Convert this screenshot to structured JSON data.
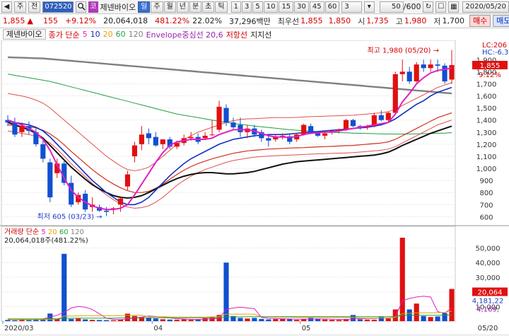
{
  "toolbar": {
    "nav_left": "◀",
    "type_label": "주",
    "prev_label": "전",
    "stock_code": "072520",
    "search_icon": "search-icon",
    "market_badge": "코",
    "stock_name": "제넨바이오",
    "period_tabs": [
      {
        "label": "일",
        "active": true
      },
      {
        "label": "주",
        "active": false
      },
      {
        "label": "월",
        "active": false
      },
      {
        "label": "년",
        "active": false
      },
      {
        "label": "분",
        "active": false
      },
      {
        "label": "초",
        "active": false
      },
      {
        "label": "틱",
        "active": false
      }
    ],
    "minute_buttons": [
      "1",
      "3",
      "5",
      "10",
      "15",
      "30",
      "45",
      "60"
    ],
    "minute_select": "3",
    "count_value": "50",
    "count_total": "/600",
    "date": "2020/05/20"
  },
  "price_bar": {
    "current_price": "1,855",
    "change_arrow": "▲",
    "change": "155",
    "change_pct": "+9.12%",
    "volume": "20,064,018",
    "volume_ratio": "481.22%",
    "turnover": "22.02%",
    "trade_value": "37,296백만",
    "best_bid_label": "최우선",
    "best_bid": "1,855",
    "best_ask": "1,850",
    "open_label": "시",
    "open": "1,735",
    "high_label": "고",
    "high": "1,980",
    "low_label": "저",
    "low": "1,700",
    "buy_label": "매수",
    "sell_label": "매도"
  },
  "legend": {
    "tab_label": "제넨바이오",
    "ma_label": "종가 단순",
    "ma_periods": [
      "5",
      "10",
      "20",
      "60",
      "120"
    ],
    "ma_colors": [
      "#e020c0",
      "#1030c0",
      "#e8a000",
      "#20a040",
      "#808080"
    ],
    "envelope_label": "Envelope중심선 20,6",
    "resistance_label": "저항선",
    "support_label": "지지선"
  },
  "chart_data": {
    "type": "candlestick",
    "x_ticks": [
      "2020/03",
      "04",
      "05",
      "05/20"
    ],
    "y_ticks": [
      1900,
      1800,
      1700,
      1600,
      1500,
      1400,
      1300,
      1200,
      1100,
      1000,
      900,
      800,
      700,
      600
    ],
    "y_range": [
      520,
      2060
    ],
    "right_labels": {
      "lc": "LC:206",
      "hc": "HC:-6.3",
      "price": "1,855",
      "pct": "9.12%"
    },
    "high_annotation": "최고 1,980 (05/20)",
    "low_annotation": "최저 605 (03/23)",
    "candles": [
      {
        "o": 1400,
        "h": 1440,
        "l": 1350,
        "c": 1380
      },
      {
        "o": 1380,
        "h": 1420,
        "l": 1260,
        "c": 1280
      },
      {
        "o": 1300,
        "h": 1380,
        "l": 1260,
        "c": 1350
      },
      {
        "o": 1350,
        "h": 1390,
        "l": 1280,
        "c": 1310
      },
      {
        "o": 1300,
        "h": 1330,
        "l": 1180,
        "c": 1200
      },
      {
        "o": 1200,
        "h": 1230,
        "l": 1050,
        "c": 1080
      },
      {
        "o": 1050,
        "h": 1080,
        "l": 720,
        "c": 760
      },
      {
        "o": 960,
        "h": 1080,
        "l": 920,
        "c": 1040
      },
      {
        "o": 1040,
        "h": 1060,
        "l": 860,
        "c": 880
      },
      {
        "o": 880,
        "h": 940,
        "l": 680,
        "c": 700
      },
      {
        "o": 720,
        "h": 800,
        "l": 700,
        "c": 780
      },
      {
        "o": 790,
        "h": 820,
        "l": 640,
        "c": 660
      },
      {
        "o": 680,
        "h": 760,
        "l": 640,
        "c": 700
      },
      {
        "o": 680,
        "h": 700,
        "l": 640,
        "c": 650
      },
      {
        "o": 650,
        "h": 680,
        "l": 605,
        "c": 640
      },
      {
        "o": 660,
        "h": 680,
        "l": 620,
        "c": 670
      },
      {
        "o": 700,
        "h": 770,
        "l": 640,
        "c": 750
      },
      {
        "o": 850,
        "h": 980,
        "l": 820,
        "c": 950
      },
      {
        "o": 1100,
        "h": 1220,
        "l": 1050,
        "c": 1190
      },
      {
        "o": 1200,
        "h": 1350,
        "l": 1150,
        "c": 1280
      },
      {
        "o": 1290,
        "h": 1330,
        "l": 1200,
        "c": 1250
      },
      {
        "o": 1260,
        "h": 1300,
        "l": 1180,
        "c": 1190
      },
      {
        "o": 1200,
        "h": 1240,
        "l": 1160,
        "c": 1240
      },
      {
        "o": 1240,
        "h": 1260,
        "l": 1160,
        "c": 1180
      },
      {
        "o": 1180,
        "h": 1230,
        "l": 1160,
        "c": 1210
      },
      {
        "o": 1210,
        "h": 1280,
        "l": 1190,
        "c": 1250
      },
      {
        "o": 1250,
        "h": 1300,
        "l": 1230,
        "c": 1260
      },
      {
        "o": 1260,
        "h": 1290,
        "l": 1200,
        "c": 1220
      },
      {
        "o": 1250,
        "h": 1300,
        "l": 1240,
        "c": 1270
      },
      {
        "o": 1280,
        "h": 1400,
        "l": 1270,
        "c": 1280
      },
      {
        "o": 1320,
        "h": 1560,
        "l": 1300,
        "c": 1510
      },
      {
        "o": 1500,
        "h": 1530,
        "l": 1350,
        "c": 1380
      },
      {
        "o": 1380,
        "h": 1420,
        "l": 1320,
        "c": 1340
      },
      {
        "o": 1360,
        "h": 1420,
        "l": 1260,
        "c": 1300
      },
      {
        "o": 1300,
        "h": 1360,
        "l": 1250,
        "c": 1330
      },
      {
        "o": 1330,
        "h": 1360,
        "l": 1260,
        "c": 1280
      },
      {
        "o": 1300,
        "h": 1320,
        "l": 1220,
        "c": 1250
      },
      {
        "o": 1250,
        "h": 1280,
        "l": 1180,
        "c": 1230
      },
      {
        "o": 1240,
        "h": 1280,
        "l": 1220,
        "c": 1265
      },
      {
        "o": 1265,
        "h": 1290,
        "l": 1240,
        "c": 1270
      },
      {
        "o": 1265,
        "h": 1290,
        "l": 1200,
        "c": 1220
      },
      {
        "o": 1240,
        "h": 1290,
        "l": 1220,
        "c": 1280
      },
      {
        "o": 1280,
        "h": 1370,
        "l": 1270,
        "c": 1360
      },
      {
        "o": 1350,
        "h": 1370,
        "l": 1290,
        "c": 1300
      },
      {
        "o": 1290,
        "h": 1310,
        "l": 1260,
        "c": 1270
      },
      {
        "o": 1270,
        "h": 1300,
        "l": 1240,
        "c": 1290
      },
      {
        "o": 1300,
        "h": 1320,
        "l": 1280,
        "c": 1310
      },
      {
        "o": 1310,
        "h": 1330,
        "l": 1290,
        "c": 1320
      },
      {
        "o": 1320,
        "h": 1410,
        "l": 1310,
        "c": 1400
      },
      {
        "o": 1400,
        "h": 1410,
        "l": 1340,
        "c": 1350
      },
      {
        "o": 1350,
        "h": 1360,
        "l": 1320,
        "c": 1340
      },
      {
        "o": 1340,
        "h": 1360,
        "l": 1320,
        "c": 1350
      },
      {
        "o": 1350,
        "h": 1460,
        "l": 1340,
        "c": 1440
      },
      {
        "o": 1440,
        "h": 1480,
        "l": 1390,
        "c": 1400
      },
      {
        "o": 1400,
        "h": 1470,
        "l": 1380,
        "c": 1460
      },
      {
        "o": 1460,
        "h": 1800,
        "l": 1450,
        "c": 1780
      },
      {
        "o": 1780,
        "h": 1900,
        "l": 1720,
        "c": 1800
      },
      {
        "o": 1800,
        "h": 1840,
        "l": 1700,
        "c": 1720
      },
      {
        "o": 1720,
        "h": 1880,
        "l": 1710,
        "c": 1860
      },
      {
        "o": 1860,
        "h": 1900,
        "l": 1800,
        "c": 1830
      },
      {
        "o": 1830,
        "h": 1900,
        "l": 1800,
        "c": 1860
      },
      {
        "o": 1860,
        "h": 1900,
        "l": 1800,
        "c": 1850
      },
      {
        "o": 1850,
        "h": 1870,
        "l": 1700,
        "c": 1720
      },
      {
        "o": 1735,
        "h": 1980,
        "l": 1700,
        "c": 1855
      }
    ],
    "ma5": [
      1400,
      1380,
      1360,
      1330,
      1300,
      1240,
      1150,
      1030,
      920,
      820,
      760,
      720,
      690,
      670,
      660,
      660,
      670,
      700,
      780,
      870,
      960,
      1050,
      1130,
      1190,
      1220,
      1230,
      1240,
      1240,
      1240,
      1250,
      1280,
      1300,
      1320,
      1320,
      1320,
      1310,
      1290,
      1270,
      1260,
      1260,
      1255,
      1265,
      1280,
      1290,
      1295,
      1300,
      1300,
      1310,
      1320,
      1330,
      1340,
      1350,
      1360,
      1370,
      1380,
      1450,
      1550,
      1620,
      1700,
      1750,
      1790,
      1810,
      1820,
      1830
    ],
    "ma20": [
      1390,
      1380,
      1370,
      1360,
      1340,
      1310,
      1260,
      1200,
      1140,
      1080,
      1020,
      960,
      900,
      850,
      800,
      760,
      720,
      700,
      700,
      720,
      760,
      820,
      880,
      940,
      990,
      1040,
      1080,
      1110,
      1140,
      1170,
      1200,
      1220,
      1240,
      1250,
      1260,
      1270,
      1275,
      1280,
      1280,
      1280,
      1285,
      1290,
      1295,
      1300,
      1305,
      1310,
      1315,
      1320,
      1325,
      1330,
      1335,
      1340,
      1350,
      1360,
      1380,
      1410,
      1450,
      1490,
      1530,
      1560,
      1600,
      1630,
      1650,
      1670
    ],
    "ma60": [
      1390,
      1385,
      1380,
      1375,
      1370,
      1360,
      1345,
      1330,
      1310,
      1290,
      1270,
      1250,
      1230,
      1210,
      1190,
      1170,
      1150,
      1130,
      1115,
      1100,
      1090,
      1080,
      1070,
      1060,
      1055,
      1050,
      1045,
      1040,
      1035,
      1030,
      1030,
      1030,
      1035,
      1040,
      1050,
      1060,
      1070,
      1080,
      1090,
      1100,
      1110,
      1120,
      1125,
      1130,
      1135,
      1140,
      1145,
      1150,
      1155,
      1160,
      1170,
      1180,
      1190,
      1200,
      1210,
      1225,
      1240,
      1255,
      1270,
      1285,
      1300,
      1315,
      1330,
      1340
    ],
    "ma120": [
      1920,
      1918,
      1916,
      1914,
      1912,
      1910,
      1905,
      1900,
      1895,
      1890,
      1885,
      1880,
      1875,
      1870,
      1865,
      1860,
      1855,
      1850,
      1845,
      1840,
      1835,
      1830,
      1825,
      1820,
      1815,
      1810,
      1805,
      1800,
      1795,
      1790,
      1785,
      1780,
      1775,
      1770,
      1765,
      1760,
      1755,
      1750,
      1745,
      1740,
      1735,
      1730,
      1725,
      1720,
      1715,
      1710,
      1705,
      1700,
      1695,
      1690,
      1685,
      1680,
      1675,
      1670,
      1665,
      1660,
      1655,
      1650,
      1645,
      1640,
      1635,
      1630,
      1625,
      1620
    ],
    "green": [
      1780,
      1770,
      1760,
      1750,
      1740,
      1730,
      1720,
      1705,
      1690,
      1675,
      1660,
      1645,
      1630,
      1615,
      1600,
      1585,
      1570,
      1555,
      1540,
      1525,
      1510,
      1495,
      1480,
      1465,
      1450,
      1440,
      1430,
      1420,
      1410,
      1400,
      1390,
      1380,
      1372,
      1365,
      1358,
      1350,
      1344,
      1338,
      1332,
      1326,
      1320,
      1316,
      1312,
      1308,
      1304,
      1300,
      1298,
      1296,
      1294,
      1292,
      1290,
      1288,
      1287,
      1286,
      1285,
      1284,
      1284,
      1285,
      1286,
      1287,
      1288,
      1290,
      1292,
      1295
    ],
    "env_upper": [
      1620,
      1610,
      1600,
      1585,
      1565,
      1540,
      1500,
      1450,
      1400,
      1350,
      1300,
      1250,
      1200,
      1150,
      1100,
      1060,
      1020,
      990,
      980,
      990,
      1010,
      1050,
      1100,
      1150,
      1200,
      1240,
      1270,
      1300,
      1320,
      1340,
      1360,
      1380,
      1395,
      1405,
      1410,
      1412,
      1415,
      1418,
      1420,
      1420,
      1420,
      1422,
      1425,
      1428,
      1430,
      1432,
      1434,
      1436,
      1438,
      1440,
      1445,
      1450,
      1455,
      1460,
      1470,
      1490,
      1520,
      1550,
      1580,
      1610,
      1640,
      1670,
      1690,
      1710
    ],
    "env_lower": [
      1310,
      1300,
      1290,
      1280,
      1265,
      1245,
      1210,
      1160,
      1100,
      1040,
      985,
      930,
      875,
      825,
      780,
      740,
      705,
      680,
      670,
      675,
      690,
      720,
      760,
      810,
      860,
      900,
      935,
      965,
      990,
      1010,
      1030,
      1050,
      1065,
      1075,
      1085,
      1092,
      1098,
      1102,
      1105,
      1108,
      1110,
      1112,
      1115,
      1118,
      1120,
      1122,
      1124,
      1126,
      1128,
      1130,
      1135,
      1140,
      1145,
      1150,
      1160,
      1180,
      1210,
      1240,
      1270,
      1300,
      1330,
      1360,
      1380,
      1400
    ],
    "support": [
      1360,
      1355,
      1350,
      1345,
      1335,
      1315,
      1285,
      1245,
      1195,
      1140,
      1090,
      1040,
      990,
      945,
      905,
      870,
      840,
      815,
      800,
      800,
      810,
      835,
      870,
      910,
      950,
      985,
      1015,
      1040,
      1060,
      1080,
      1095,
      1110,
      1125,
      1135,
      1145,
      1150,
      1155,
      1160,
      1162,
      1165,
      1168,
      1170,
      1172,
      1175,
      1178,
      1180,
      1182,
      1185,
      1188,
      1190,
      1195,
      1200,
      1205,
      1210,
      1220,
      1240,
      1270,
      1300,
      1330,
      1360,
      1390,
      1420,
      1440,
      1460
    ],
    "black": [
      1380,
      1360,
      1340,
      1320,
      1290,
      1250,
      1190,
      1130,
      1070,
      1010,
      960,
      910,
      865,
      830,
      800,
      775,
      760,
      755,
      760,
      775,
      800,
      830,
      860,
      890,
      915,
      935,
      950,
      960,
      965,
      965,
      960,
      955,
      955,
      960,
      965,
      975,
      990,
      1005,
      1020,
      1035,
      1045,
      1055,
      1060,
      1065,
      1070,
      1075,
      1080,
      1085,
      1090,
      1095,
      1100,
      1105,
      1110,
      1120,
      1135,
      1160,
      1190,
      1215,
      1240,
      1265,
      1290,
      1310,
      1330,
      1350
    ],
    "volume": {
      "label": "거래량",
      "ma_label": "단순",
      "ma_periods": [
        "5",
        "20",
        "60",
        "120"
      ],
      "ma_colors": [
        "#e020c0",
        "#e8a000",
        "#20a040",
        "#808080"
      ],
      "current_text": "20,064,018주(481.22%)",
      "y_ticks": [
        "50,000",
        "40,000",
        "30,000",
        "20,000",
        "10,000"
      ],
      "y_max": 58000,
      "current_label": "20,064",
      "ma_value_label": "4,169,",
      "ma_value_label2": "4,181,22",
      "values": [
        800,
        600,
        900,
        700,
        1100,
        1200,
        5200,
        1800,
        46000,
        1500,
        1800,
        1200,
        900,
        800,
        700,
        600,
        1200,
        5100,
        3500,
        2800,
        2200,
        1800,
        1300,
        1100,
        1000,
        1200,
        900,
        1100,
        2000,
        2800,
        4200,
        40000,
        3500,
        2200,
        1800,
        2200,
        1500,
        1200,
        1400,
        1800,
        1500,
        900,
        1600,
        2200,
        1400,
        1100,
        900,
        800,
        1500,
        4200,
        1300,
        1100,
        1000,
        3200,
        1800,
        8000,
        57000,
        8000,
        12000,
        3500,
        2800,
        3200,
        5500,
        22000
      ],
      "vol_ma5": [
        1500,
        1400,
        1300,
        1200,
        1300,
        1500,
        2800,
        4000,
        6000,
        9000,
        10000,
        9500,
        8000,
        5000,
        2000,
        1200,
        1000,
        1500,
        2200,
        2800,
        3500,
        3200,
        2800,
        2200,
        1700,
        1400,
        1200,
        1200,
        1300,
        1500,
        2000,
        8000,
        9000,
        9500,
        9000,
        8500,
        2500,
        2000,
        1800,
        1600,
        1500,
        1400,
        1400,
        1500,
        1600,
        1500,
        1400,
        1200,
        1100,
        1600,
        1800,
        1800,
        1800,
        2200,
        2000,
        3000,
        14000,
        15500,
        16500,
        17000,
        16500,
        6500,
        5500,
        9000
      ],
      "vol_ma20": [
        1000,
        1000,
        1000,
        1000,
        1000,
        1050,
        1200,
        1300,
        3500,
        3500,
        3600,
        3700,
        3700,
        3700,
        3700,
        3700,
        3700,
        3900,
        4000,
        4100,
        3000,
        3000,
        3000,
        2900,
        2800,
        2800,
        2800,
        2800,
        2800,
        2900,
        3000,
        4800,
        4800,
        4800,
        4800,
        4800,
        2900,
        2900,
        2800,
        2700,
        2700,
        2600,
        2600,
        2600,
        2600,
        2600,
        2600,
        2500,
        2500,
        2600,
        2200,
        2100,
        2100,
        2200,
        2200,
        2500,
        5200,
        5300,
        5700,
        5700,
        5700,
        5800,
        6000,
        6900
      ],
      "vol_ma60": [
        1500,
        1500,
        1500,
        1500,
        1500,
        1500,
        1600,
        1600,
        2000,
        2000,
        2100,
        2100,
        2100,
        2100,
        2100,
        2100,
        2200,
        2200,
        2200,
        2300,
        2300,
        2300,
        2300,
        2300,
        2300,
        2300,
        2300,
        2300,
        2300,
        2300,
        2400,
        2900,
        2900,
        2900,
        3000,
        3000,
        3000,
        3000,
        3000,
        3000,
        3000,
        3000,
        3000,
        3000,
        3000,
        3000,
        3000,
        3000,
        3000,
        3000,
        3000,
        3000,
        3000,
        3000,
        3100,
        3100,
        3900,
        3900,
        4000,
        4000,
        4000,
        4000,
        4100,
        4200
      ]
    }
  }
}
